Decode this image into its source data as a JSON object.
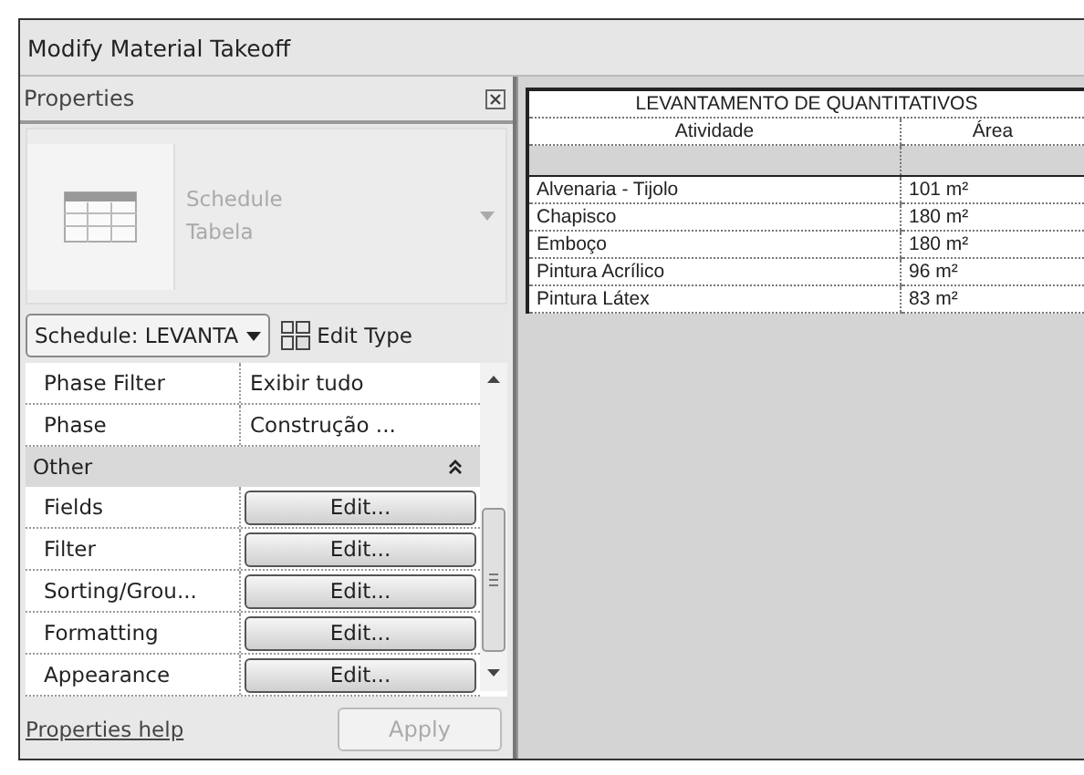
{
  "window": {
    "title": "Modify Material Takeoff"
  },
  "properties": {
    "title": "Properties",
    "type_selector": {
      "line_1": "Schedule",
      "line_2": "Tabela"
    },
    "instance_dropdown": "Schedule: LEVANTA",
    "edit_type": "Edit Type",
    "rows": [
      {
        "kind": "param",
        "name": "Phase Filter",
        "value": "Exibir tudo"
      },
      {
        "kind": "param",
        "name": "Phase",
        "value": "Construção ..."
      },
      {
        "kind": "group",
        "name": "Other",
        "expanded": true
      },
      {
        "kind": "button",
        "name": "Fields",
        "button": "Edit..."
      },
      {
        "kind": "button",
        "name": "Filter",
        "button": "Edit..."
      },
      {
        "kind": "button",
        "name": "Sorting/Grou...",
        "button": "Edit..."
      },
      {
        "kind": "button",
        "name": "Formatting",
        "button": "Edit..."
      },
      {
        "kind": "button",
        "name": "Appearance",
        "button": "Edit..."
      }
    ],
    "help_link": "Properties help",
    "apply": {
      "label": "Apply",
      "disabled": true
    }
  },
  "schedule": {
    "title": "LEVANTAMENTO DE QUANTITATIVOS",
    "columns": [
      "Atividade",
      "Área"
    ],
    "rows": [
      [
        "Alvenaria - Tijolo",
        "101 m²"
      ],
      [
        "Chapisco",
        "180 m²"
      ],
      [
        "Emboço",
        "180 m²"
      ],
      [
        "Pintura Acrílico",
        "96 m²"
      ],
      [
        "Pintura Látex",
        "83 m²"
      ]
    ]
  }
}
